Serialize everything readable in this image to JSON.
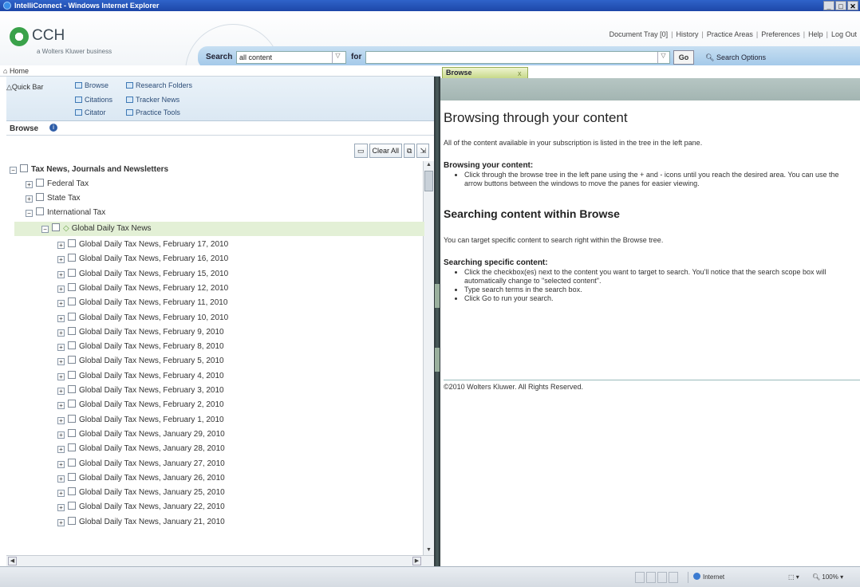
{
  "window": {
    "title": "IntelliConnect - Windows Internet Explorer",
    "controls": [
      "_",
      "□",
      "✕"
    ]
  },
  "header": {
    "logo": "CCH",
    "logo_sub": "a Wolters Kluwer business",
    "links": [
      "Document Tray [0]",
      "History",
      "Practice Areas",
      "Preferences",
      "Help",
      "Log Out"
    ],
    "search_label": "Search",
    "scope_value": "all content",
    "for_label": "for",
    "query_value": "",
    "go_label": "Go",
    "search_options": "Search Options"
  },
  "homebar": {
    "home_label": "Home"
  },
  "quickbar": {
    "tab_label": "Quick Bar",
    "links": [
      "Browse",
      "Research Folders",
      "Citations",
      "Tracker News",
      "Citator",
      "Practice Tools"
    ]
  },
  "browse": {
    "title": "Browse",
    "buttons": [
      "Clear All"
    ]
  },
  "tree": {
    "root": "Tax News, Journals and Newsletters",
    "children": [
      "Federal Tax",
      "State Tax",
      "International Tax"
    ],
    "selected": "Global Daily Tax News",
    "items": [
      "Global Daily Tax News, February 17, 2010",
      "Global Daily Tax News, February 16, 2010",
      "Global Daily Tax News, February 15, 2010",
      "Global Daily Tax News, February 12, 2010",
      "Global Daily Tax News, February 11, 2010",
      "Global Daily Tax News, February 10, 2010",
      "Global Daily Tax News, February 9, 2010",
      "Global Daily Tax News, February 8, 2010",
      "Global Daily Tax News, February 5, 2010",
      "Global Daily Tax News, February 4, 2010",
      "Global Daily Tax News, February 3, 2010",
      "Global Daily Tax News, February 2, 2010",
      "Global Daily Tax News, February 1, 2010",
      "Global Daily Tax News, January 29, 2010",
      "Global Daily Tax News, January 28, 2010",
      "Global Daily Tax News, January 27, 2010",
      "Global Daily Tax News, January 26, 2010",
      "Global Daily Tax News, January 25, 2010",
      "Global Daily Tax News, January 22, 2010",
      "Global Daily Tax News, January 21, 2010"
    ]
  },
  "right": {
    "tab_label": "Browse",
    "tab_close": "x",
    "heading": "Browsing through your content",
    "intro": "All of the content available in your subscription is listed in the tree in the left pane.",
    "sub1": "Browsing your content:",
    "bullets1": [
      "Click through the browse tree in the left pane using the + and - icons until you reach the desired area. You can use the arrow buttons between the windows to move the panes for easier viewing."
    ],
    "heading2": "Searching content within Browse",
    "para2": "You can target specific content to search right within the Browse tree.",
    "sub2": "Searching specific content:",
    "bullets2": [
      "Click the checkbox(es) next to the content you want to target to search. You'll notice that the search scope box will automatically change to \"selected content\".",
      "Type search terms in the search box.",
      "Click Go to run your search."
    ],
    "copyright": "©2010 Wolters Kluwer. All Rights Reserved."
  },
  "statusbar": {
    "zone": "Internet",
    "zoom": "100%"
  }
}
